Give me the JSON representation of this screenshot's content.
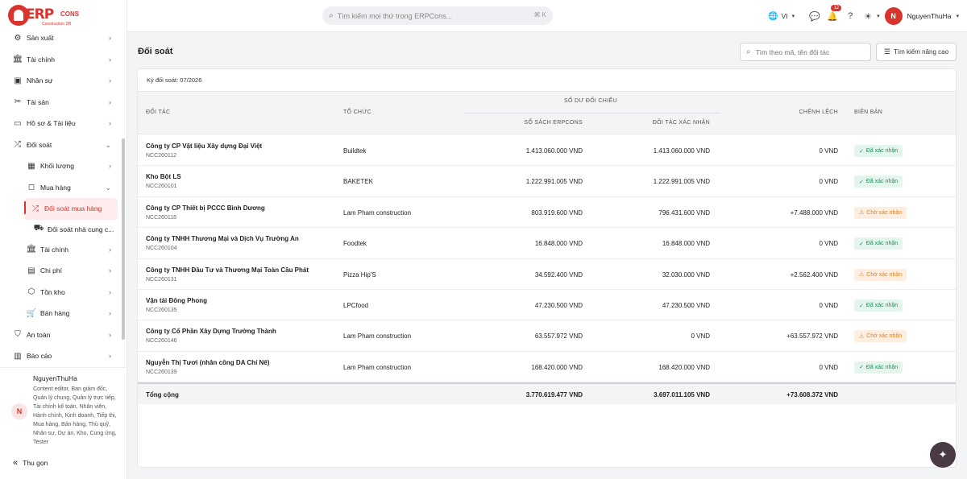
{
  "brand": {
    "logo_text": "ERP",
    "logo_cons": "CONS",
    "logo_sub": "Construction DB"
  },
  "sidebar": {
    "items": [
      {
        "label": "Sản xuất",
        "icon": "gear-icon"
      },
      {
        "label": "Tài chính",
        "icon": "bank-icon"
      },
      {
        "label": "Nhân sự",
        "icon": "person-badge-icon"
      },
      {
        "label": "Tài sản",
        "icon": "tools-icon"
      },
      {
        "label": "Hồ sơ & Tài liệu",
        "icon": "folder-icon"
      },
      {
        "label": "Đối soát",
        "icon": "shuffle-icon"
      },
      {
        "label": "Khối lượng",
        "icon": "blocks-icon"
      },
      {
        "label": "Mua hàng",
        "icon": "shopping-bag-icon"
      },
      {
        "label": "Đối soát mua hàng",
        "icon": "shuffle-icon"
      },
      {
        "label": "Đối soát nhà cung c...",
        "icon": "supplier-icon"
      },
      {
        "label": "Tài chính",
        "icon": "bank-icon"
      },
      {
        "label": "Chi phí",
        "icon": "wallet-icon"
      },
      {
        "label": "Tồn kho",
        "icon": "box-icon"
      },
      {
        "label": "Bán hàng",
        "icon": "cart-icon"
      },
      {
        "label": "An toàn",
        "icon": "shield-icon"
      },
      {
        "label": "Báo cáo",
        "icon": "bar-chart-icon"
      }
    ],
    "user": {
      "initial": "N",
      "name": "NguyenThuHa",
      "roles": "Content editor, Ban giám đốc, Quản lý chung, Quản lý trực tiếp, Tài chính kế toán, Nhân viên, Hành chính, Kinh doanh, Tiếp thị, Mua hàng, Bán hàng, Thủ quỹ, Nhân sự, Dự án, Kho, Cung ứng, Tester"
    },
    "collapse_label": "Thu gọn"
  },
  "topbar": {
    "search_placeholder": "Tìm kiếm mọi thứ trong ERPCons...",
    "search_shortcut": "⌘ K",
    "language": "VI",
    "notification_count": "12",
    "user_initial": "N",
    "user_name": "NguyenThuHa"
  },
  "page": {
    "title": "Đối soát",
    "filter_placeholder": "Tìm theo mã, tên đối tác",
    "advanced_search": "Tìm kiếm nâng cao",
    "period": "Kỳ đối soát: 07/2026"
  },
  "table": {
    "headers": {
      "partner": "ĐỐI TÁC",
      "org": "TỔ CHỨC",
      "balance_group": "SỐ DƯ ĐỐI CHIẾU",
      "erp_books": "SỔ SÁCH ERPCONS",
      "partner_confirmed": "ĐỐI TÁC XÁC NHẬN",
      "difference": "CHÊNH LỆCH",
      "minutes": "BIÊN BẢN"
    },
    "rows": [
      {
        "name": "Công ty CP Vật liệu Xây dựng Đại Việt",
        "code": "NCC260112",
        "org": "Buildtek",
        "erp": "1.413.060.000 VND",
        "partner": "1.413.060.000 VND",
        "diff": "0 VND",
        "status": "Đã xác nhận",
        "state": "ok"
      },
      {
        "name": "Kho Bột LS",
        "code": "NCC260101",
        "org": "BAKETEK",
        "erp": "1.222.991.005 VND",
        "partner": "1.222.991.005 VND",
        "diff": "0 VND",
        "status": "Đã xác nhận",
        "state": "ok"
      },
      {
        "name": "Công ty CP Thiết bị PCCC Bình Dương",
        "code": "NCC260118",
        "org": "Lam Pham construction",
        "erp": "803.919.600 VND",
        "partner": "796.431.600 VND",
        "diff": "+7.488.000 VND",
        "status": "Chờ xác nhận",
        "state": "wait"
      },
      {
        "name": "Công ty TNHH Thương Mại và Dịch Vụ Trường An",
        "code": "NCC260104",
        "org": "Foodtek",
        "erp": "16.848.000 VND",
        "partner": "16.848.000 VND",
        "diff": "0 VND",
        "status": "Đã xác nhận",
        "state": "ok"
      },
      {
        "name": "Công ty TNHH Đầu Tư và Thương Mại Toàn Cầu Phát",
        "code": "NCC260131",
        "org": "Pizza Hip'S",
        "erp": "34.592.400 VND",
        "partner": "32.030.000 VND",
        "diff": "+2.562.400 VND",
        "status": "Chờ xác nhận",
        "state": "wait"
      },
      {
        "name": "Vận tải Đông Phong",
        "code": "NCC260135",
        "org": "LPCfood",
        "erp": "47.230.500 VND",
        "partner": "47.230.500 VND",
        "diff": "0 VND",
        "status": "Đã xác nhận",
        "state": "ok"
      },
      {
        "name": "Công ty Cổ Phần Xây Dựng Trường Thành",
        "code": "NCC260146",
        "org": "Lam Pham construction",
        "erp": "63.557.972 VND",
        "partner": "0 VND",
        "diff": "+63.557.972 VND",
        "status": "Chờ xác nhận",
        "state": "wait"
      },
      {
        "name": "Nguyễn Thị Tươi (nhân công DA Chí Nê)",
        "code": "NCC260139",
        "org": "Lam Pham construction",
        "erp": "168.420.000 VND",
        "partner": "168.420.000 VND",
        "diff": "0 VND",
        "status": "Đã xác nhận",
        "state": "ok"
      }
    ],
    "total": {
      "label": "Tổng cộng",
      "erp": "3.770.619.477 VND",
      "partner": "3.697.011.105 VND",
      "diff": "+73.608.372 VND"
    }
  },
  "colors": {
    "accent": "#d9342b",
    "ok": "#16935a",
    "wait": "#d9832b"
  }
}
